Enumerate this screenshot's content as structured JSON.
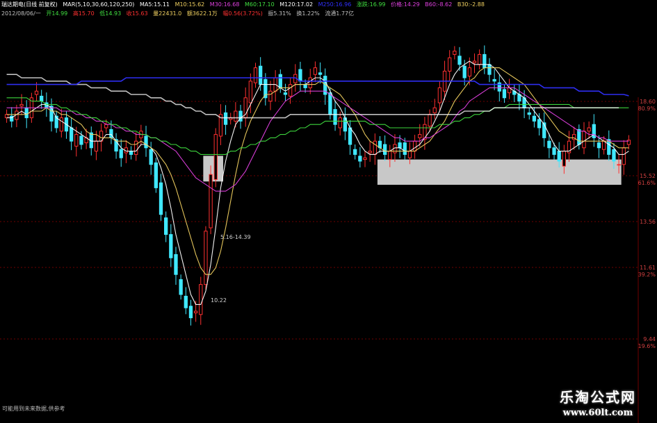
{
  "header": {
    "title": "瑞达期电(日线 前复权)",
    "indicator": "MAR(5,10,30,60,120,250)",
    "ma5": "MA5:15.11",
    "ma10": "M10:15.62",
    "ma30": "M30:16.68",
    "ma60": "M60:17.10",
    "ma120": "M120:17.02",
    "ma250": "M250:16.96",
    "up": "涨跌:16.99",
    "cost": "价格:14.29",
    "b60": "B60:-8.62",
    "b30": "B30:-2.88"
  },
  "quote": {
    "date": "2012/08/06/一",
    "open": "开14.99",
    "high": "高15.70",
    "low": "低14.93",
    "close": "收15.63",
    "volume": "量22431.0",
    "amount": "额3622.1万",
    "change": "幅0.56(3.72%)",
    "amplitude": "振5.31%",
    "turnover": "换1.22%",
    "float": "流通1.77亿"
  },
  "annotations": {
    "range": "5.16-14.39",
    "low": "10.22"
  },
  "footer": "可能用到未来数据,供参考",
  "watermark": {
    "line1": "乐淘公式网",
    "line2": "www.60lt.com"
  },
  "colors": {
    "up": "#ff3030",
    "down": "#40e8ff",
    "ma5": "#ffffff",
    "ma10": "#f0d060",
    "ma30": "#e040e0",
    "ma60": "#40e040",
    "ma120": "#ffffff",
    "ma250": "#3030ff",
    "grid": "#700000"
  },
  "chart_data": {
    "type": "candlestick",
    "title": "瑞达期电(日线 前复权)",
    "y_tick_labels": [
      "18.60",
      "80.9%",
      "15.52",
      "61.6%",
      "13.56",
      "11.61",
      "39.2%",
      "9.44",
      "19.6%"
    ],
    "y_range": [
      9.0,
      19.0
    ],
    "price_low": 10.22,
    "price_high": 18.6,
    "last_close": 15.63,
    "closes": [
      16.4,
      16.2,
      16.5,
      16.7,
      16.3,
      16.9,
      17.1,
      16.8,
      16.6,
      16.2,
      16.0,
      16.3,
      15.9,
      15.6,
      15.8,
      15.5,
      15.7,
      15.4,
      15.6,
      15.9,
      16.1,
      15.7,
      15.3,
      15.1,
      15.4,
      15.2,
      15.6,
      15.9,
      15.4,
      14.9,
      14.2,
      13.4,
      12.8,
      12.1,
      11.6,
      11.0,
      10.6,
      10.3,
      10.5,
      11.3,
      12.9,
      14.6,
      15.8,
      16.4,
      16.1,
      16.3,
      16.5,
      16.2,
      16.9,
      17.4,
      17.8,
      17.3,
      16.9,
      17.1,
      17.5,
      17.2,
      17.0,
      17.3,
      17.6,
      17.4,
      17.2,
      17.5,
      17.8,
      17.6,
      17.0,
      16.4,
      16.1,
      16.3,
      15.9,
      15.5,
      15.2,
      15.0,
      15.1,
      15.3,
      15.6,
      15.4,
      15.2,
      15.3,
      15.5,
      15.4,
      15.2,
      15.3,
      15.6,
      15.8,
      16.1,
      16.4,
      16.6,
      17.2,
      17.7,
      18.1,
      18.3,
      17.9,
      17.5,
      17.8,
      18.0,
      18.2,
      17.8,
      17.6,
      17.4,
      17.1,
      16.9,
      17.2,
      17.0,
      16.8,
      16.6,
      16.4,
      16.2,
      16.0,
      15.7,
      15.4,
      15.2,
      15.0,
      15.3,
      15.6,
      15.8,
      15.5,
      15.9,
      16.0,
      15.7,
      15.4,
      15.6,
      15.2,
      15.0,
      14.9,
      15.4,
      15.63
    ],
    "series": [
      {
        "name": "MA5",
        "values": [
          16.3,
          16.3,
          16.4,
          16.5,
          16.4,
          16.5,
          16.6,
          16.7,
          16.7,
          16.6,
          16.3,
          16.2,
          16.1,
          16.0,
          15.9,
          15.8,
          15.7,
          15.6,
          15.6,
          15.6,
          15.8,
          15.8,
          15.6,
          15.4,
          15.3,
          15.3,
          15.3,
          15.5,
          15.5,
          15.4,
          15.2,
          14.8,
          14.3,
          13.6,
          12.8,
          12.2,
          11.6,
          11.0,
          10.7,
          10.7,
          11.1,
          11.9,
          13.0,
          14.2,
          15.0,
          15.6,
          16.1,
          16.3,
          16.4,
          16.7,
          17.0,
          17.3,
          17.3,
          17.3,
          17.3,
          17.2,
          17.1,
          17.2,
          17.3,
          17.3,
          17.3,
          17.4,
          17.5,
          17.5,
          17.4,
          17.1,
          16.8,
          16.6,
          16.3,
          16.0,
          15.8,
          15.5,
          15.3,
          15.2,
          15.2,
          15.3,
          15.3,
          15.3,
          15.4,
          15.4,
          15.3,
          15.3,
          15.4,
          15.5,
          15.7,
          15.9,
          16.2,
          16.5,
          16.9,
          17.3,
          17.6,
          17.8,
          17.9,
          18.0,
          17.9,
          17.9,
          17.9,
          17.9,
          17.8,
          17.6,
          17.4,
          17.2,
          17.1,
          17.0,
          16.9,
          16.7,
          16.5,
          16.3,
          16.1,
          15.8,
          15.5,
          15.3,
          15.3,
          15.3,
          15.4,
          15.5,
          15.6,
          15.7,
          15.8,
          15.7,
          15.6,
          15.5,
          15.4,
          15.2,
          15.2,
          15.3
        ]
      },
      {
        "name": "MA10",
        "values": [
          16.4,
          16.4,
          16.4,
          16.4,
          16.4,
          16.5,
          16.5,
          16.5,
          16.6,
          16.5,
          16.5,
          16.4,
          16.4,
          16.3,
          16.2,
          16.1,
          15.9,
          15.8,
          15.8,
          15.7,
          15.7,
          15.7,
          15.6,
          15.6,
          15.6,
          15.5,
          15.5,
          15.6,
          15.5,
          15.4,
          15.3,
          15.1,
          14.9,
          14.6,
          14.2,
          13.7,
          13.2,
          12.7,
          12.2,
          11.8,
          11.6,
          11.6,
          11.8,
          12.3,
          13.0,
          13.8,
          14.6,
          15.3,
          15.8,
          16.2,
          16.5,
          16.8,
          17.0,
          17.0,
          17.1,
          17.2,
          17.2,
          17.2,
          17.3,
          17.3,
          17.3,
          17.3,
          17.3,
          17.4,
          17.3,
          17.2,
          17.1,
          17.0,
          16.8,
          16.6,
          16.4,
          16.1,
          15.8,
          15.6,
          15.5,
          15.4,
          15.3,
          15.3,
          15.3,
          15.3,
          15.3,
          15.3,
          15.3,
          15.4,
          15.5,
          15.6,
          15.8,
          16.0,
          16.2,
          16.5,
          16.8,
          17.0,
          17.2,
          17.4,
          17.5,
          17.7,
          17.8,
          17.8,
          17.8,
          17.8,
          17.7,
          17.6,
          17.5,
          17.4,
          17.3,
          17.1,
          16.9,
          16.7,
          16.5,
          16.3,
          16.1,
          15.9,
          15.8,
          15.7,
          15.7,
          15.6,
          15.6,
          15.6,
          15.6,
          15.6,
          15.6,
          15.6,
          15.5,
          15.4,
          15.4,
          15.4
        ]
      },
      {
        "name": "MA30",
        "values": [
          16.6,
          16.6,
          16.6,
          16.6,
          16.6,
          16.6,
          16.6,
          16.6,
          16.6,
          16.6,
          16.6,
          16.5,
          16.5,
          16.5,
          16.4,
          16.4,
          16.3,
          16.3,
          16.2,
          16.2,
          16.1,
          16.1,
          16.0,
          16.0,
          15.9,
          15.9,
          15.8,
          15.8,
          15.8,
          15.7,
          15.7,
          15.6,
          15.5,
          15.4,
          15.3,
          15.1,
          14.9,
          14.7,
          14.5,
          14.4,
          14.3,
          14.2,
          14.1,
          14.1,
          14.1,
          14.2,
          14.3,
          14.5,
          14.7,
          15.0,
          15.3,
          15.6,
          15.9,
          16.2,
          16.4,
          16.6,
          16.8,
          16.9,
          17.0,
          17.1,
          17.1,
          17.1,
          17.1,
          17.1,
          17.1,
          17.0,
          16.9,
          16.8,
          16.7,
          16.6,
          16.5,
          16.4,
          16.3,
          16.2,
          16.1,
          16.0,
          15.9,
          15.8,
          15.7,
          15.7,
          15.6,
          15.6,
          15.6,
          15.6,
          15.7,
          15.7,
          15.8,
          15.9,
          16.0,
          16.1,
          16.3,
          16.5,
          16.6,
          16.8,
          16.9,
          17.0,
          17.1,
          17.2,
          17.2,
          17.2,
          17.2,
          17.2,
          17.2,
          17.1,
          17.0,
          16.9,
          16.8,
          16.7,
          16.6,
          16.5,
          16.4,
          16.3,
          16.2,
          16.1,
          16.0,
          15.9,
          15.9,
          15.8,
          15.8,
          15.7,
          15.7,
          15.6,
          15.6,
          15.6,
          15.6,
          15.6
        ]
      },
      {
        "name": "MA60",
        "values": [
          16.9,
          16.9,
          16.9,
          16.9,
          16.9,
          16.8,
          16.8,
          16.8,
          16.7,
          16.7,
          16.7,
          16.6,
          16.6,
          16.5,
          16.5,
          16.4,
          16.4,
          16.3,
          16.3,
          16.2,
          16.2,
          16.1,
          16.1,
          16.0,
          16.0,
          15.9,
          15.9,
          15.8,
          15.8,
          15.7,
          15.7,
          15.6,
          15.6,
          15.5,
          15.5,
          15.4,
          15.4,
          15.3,
          15.3,
          15.2,
          15.2,
          15.2,
          15.2,
          15.2,
          15.2,
          15.3,
          15.3,
          15.4,
          15.4,
          15.5,
          15.5,
          15.6,
          15.6,
          15.7,
          15.7,
          15.8,
          15.8,
          15.9,
          15.9,
          16.0,
          16.0,
          16.1,
          16.1,
          16.1,
          16.2,
          16.2,
          16.2,
          16.2,
          16.2,
          16.2,
          16.2,
          16.2,
          16.2,
          16.1,
          16.1,
          16.1,
          16.1,
          16.0,
          16.0,
          16.0,
          16.0,
          16.0,
          16.0,
          16.0,
          16.0,
          16.0,
          16.0,
          16.1,
          16.1,
          16.1,
          16.2,
          16.2,
          16.3,
          16.3,
          16.4,
          16.4,
          16.5,
          16.5,
          16.6,
          16.6,
          16.6,
          16.7,
          16.7,
          16.7,
          16.7,
          16.7,
          16.7,
          16.7,
          16.7,
          16.7,
          16.7,
          16.7,
          16.7,
          16.7,
          16.6,
          16.6,
          16.6,
          16.6,
          16.6,
          16.6,
          16.6,
          16.6,
          16.6,
          16.6,
          16.6,
          16.6
        ]
      },
      {
        "name": "MA120",
        "values": [
          17.6,
          17.6,
          17.6,
          17.5,
          17.5,
          17.5,
          17.5,
          17.5,
          17.4,
          17.4,
          17.4,
          17.4,
          17.4,
          17.3,
          17.3,
          17.3,
          17.3,
          17.2,
          17.2,
          17.2,
          17.2,
          17.1,
          17.1,
          17.1,
          17.1,
          17.0,
          17.0,
          17.0,
          17.0,
          16.9,
          16.9,
          16.9,
          16.8,
          16.8,
          16.7,
          16.7,
          16.6,
          16.6,
          16.5,
          16.5,
          16.4,
          16.4,
          16.4,
          16.3,
          16.3,
          16.3,
          16.3,
          16.3,
          16.3,
          16.3,
          16.3,
          16.3,
          16.3,
          16.3,
          16.3,
          16.3,
          16.3,
          16.4,
          16.4,
          16.4,
          16.4,
          16.4,
          16.4,
          16.4,
          16.4,
          16.4,
          16.4,
          16.4,
          16.4,
          16.4,
          16.4,
          16.4,
          16.4,
          16.4,
          16.4,
          16.4,
          16.4,
          16.4,
          16.4,
          16.4,
          16.4,
          16.4,
          16.4,
          16.4,
          16.4,
          16.4,
          16.4,
          16.4,
          16.4,
          16.4,
          16.4,
          16.4,
          16.5,
          16.5,
          16.5,
          16.5,
          16.5,
          16.5,
          16.6,
          16.6,
          16.6,
          16.6,
          16.6,
          16.6,
          16.6,
          16.6,
          16.6,
          16.6,
          16.6,
          16.6,
          16.6,
          16.6,
          16.6,
          16.6,
          16.6,
          16.6,
          16.6,
          16.6,
          16.6,
          16.6,
          16.6,
          16.6,
          16.6,
          16.6
        ]
      },
      {
        "name": "MA250",
        "values": [
          17.3,
          17.3,
          17.3,
          17.3,
          17.3,
          17.3,
          17.3,
          17.3,
          17.3,
          17.3,
          17.3,
          17.3,
          17.3,
          17.3,
          17.3,
          17.4,
          17.4,
          17.4,
          17.4,
          17.4,
          17.4,
          17.4,
          17.4,
          17.4,
          17.5,
          17.5,
          17.5,
          17.5,
          17.5,
          17.5,
          17.5,
          17.5,
          17.5,
          17.5,
          17.5,
          17.5,
          17.5,
          17.5,
          17.5,
          17.5,
          17.5,
          17.5,
          17.5,
          17.5,
          17.5,
          17.5,
          17.5,
          17.5,
          17.5,
          17.5,
          17.5,
          17.5,
          17.5,
          17.5,
          17.5,
          17.5,
          17.5,
          17.5,
          17.5,
          17.4,
          17.4,
          17.4,
          17.4,
          17.4,
          17.4,
          17.4,
          17.4,
          17.4,
          17.4,
          17.4,
          17.4,
          17.4,
          17.4,
          17.4,
          17.4,
          17.4,
          17.4,
          17.4,
          17.4,
          17.4,
          17.4,
          17.4,
          17.4,
          17.4,
          17.4,
          17.4,
          17.4,
          17.4,
          17.4,
          17.4,
          17.4,
          17.4,
          17.4,
          17.4,
          17.4,
          17.3,
          17.3,
          17.3,
          17.3,
          17.3,
          17.3,
          17.3,
          17.3,
          17.3,
          17.3,
          17.3,
          17.3,
          17.3,
          17.2,
          17.2,
          17.2,
          17.2,
          17.2,
          17.2,
          17.2,
          17.1,
          17.1,
          17.1,
          17.1,
          17.1,
          17.0,
          17.0,
          17.0,
          17.0,
          17.0,
          16.96
        ]
      }
    ],
    "boxes": [
      {
        "x_from": 40,
        "x_to": 44,
        "y_from": 14.39,
        "y_to": 15.16
      },
      {
        "x_from": 75,
        "x_to": 124,
        "y_from": 14.29,
        "y_to": 15.05
      }
    ]
  }
}
